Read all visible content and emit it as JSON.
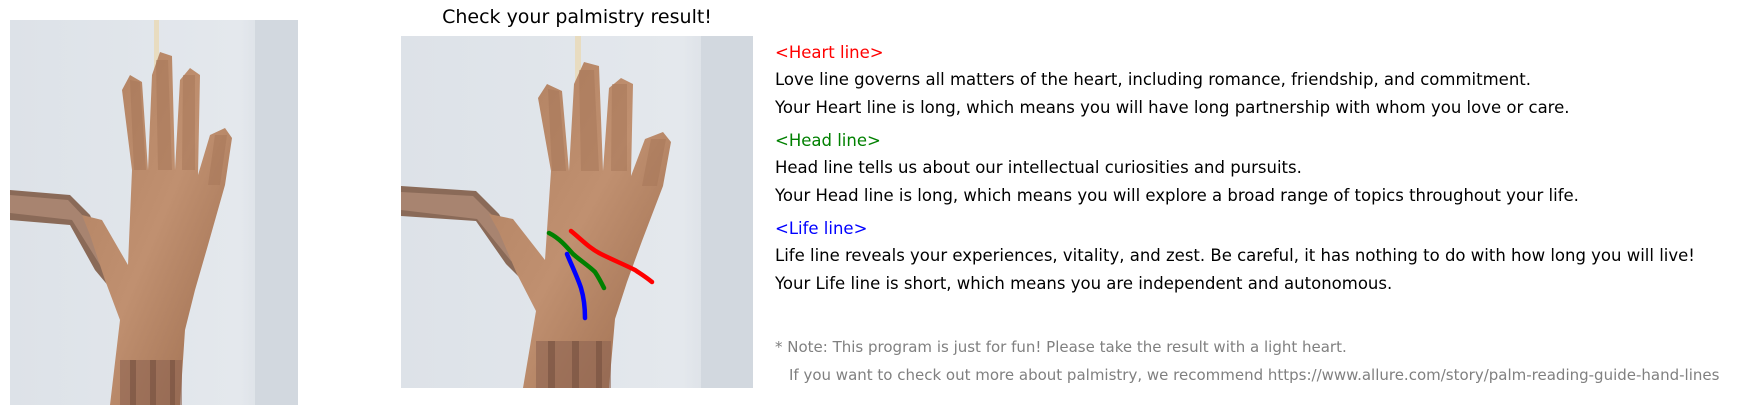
{
  "title": "Check your palmistry result!",
  "colors": {
    "heart": "#ff0000",
    "head": "#008000",
    "life": "#0000ff",
    "note": "#808080"
  },
  "lines": [
    {
      "heading": "<Heart line>",
      "description": "Love line governs all matters of the heart, including romance, friendship, and commitment.",
      "result": "Your Heart line is long, which means you will have long partnership with whom you love or care."
    },
    {
      "heading": "<Head line>",
      "description": "Head line tells us about our intellectual curiosities and pursuits.",
      "result": "Your Head line is long, which means you will explore a broad range of topics throughout your life."
    },
    {
      "heading": "<Life line>",
      "description": "Life line reveals your experiences, vitality, and zest. Be careful, it has nothing to do with how long you will live!",
      "result": "Your Life line is short, which means you are independent and autonomous."
    }
  ],
  "note": {
    "line1": "* Note: This program is just for fun! Please take the result with a light heart.",
    "line2": "If you want to check out more about palmistry, we recommend https://www.allure.com/story/palm-reading-guide-hand-lines"
  }
}
